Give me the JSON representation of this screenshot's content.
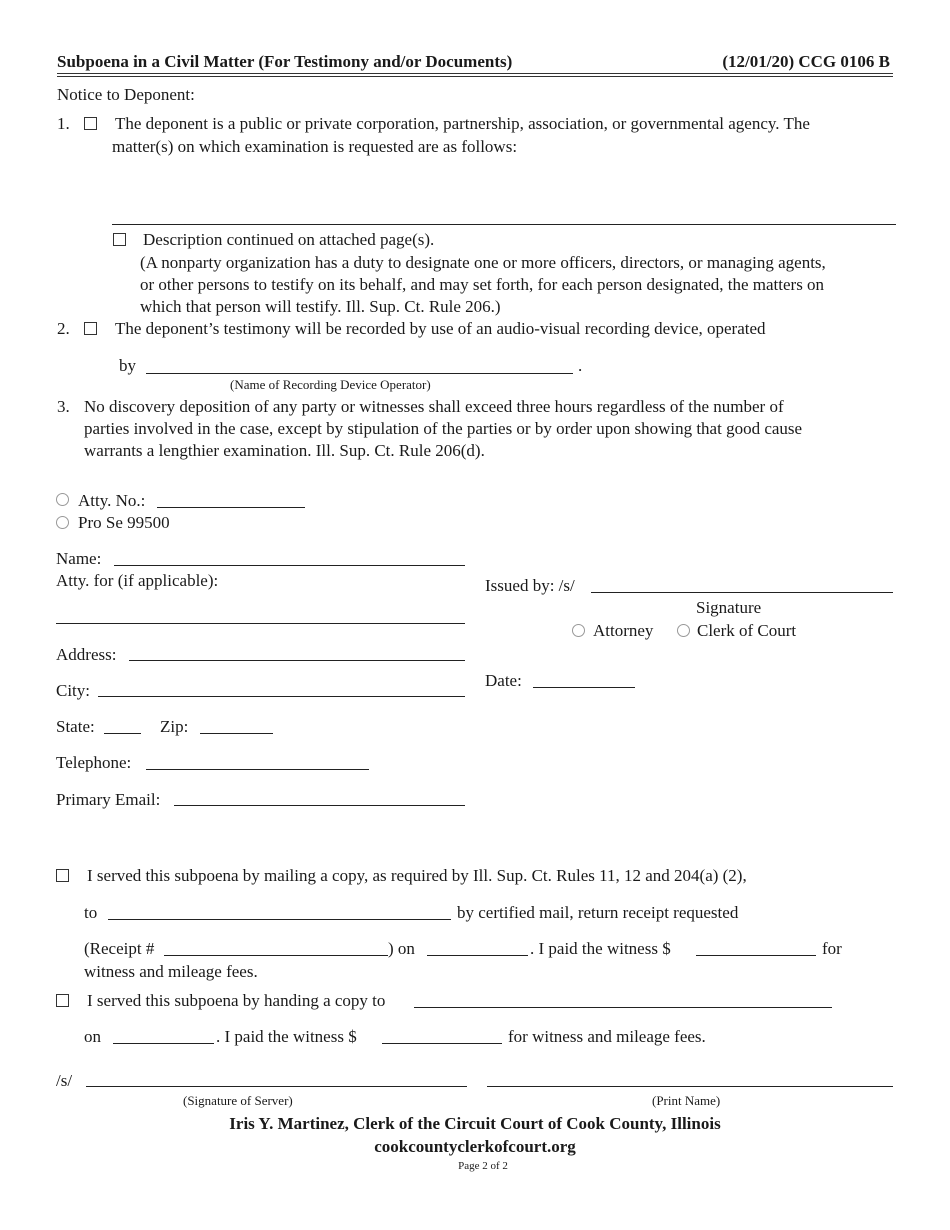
{
  "header": {
    "title": "Subpoena in a Civil Matter (For Testimony and/or Documents)",
    "form_code": "(12/01/20) CCG 0106 B"
  },
  "notice": {
    "heading": "Notice to Deponent:",
    "item1": {
      "number": "1.",
      "line1": "The deponent is a public or private corporation, partnership, association, or governmental agency.  The",
      "line2": "matter(s) on which examination is requested are as follows:",
      "matters_value": ""
    },
    "continued": {
      "label": "Description continued on attached page(s).",
      "note_lines": [
        "(A nonparty organization has a duty to designate one or more officers, directors, or managing agents,",
        "or other persons to testify on its behalf, and may set forth, for each person designated, the matters on",
        "which that person will testify.  Ill. Sup. Ct. Rule 206.)"
      ]
    },
    "item2": {
      "number": "2.",
      "text": "The deponent’s testimony will be recorded by use of an audio-visual recording device, operated",
      "by_label": "by",
      "period": ".",
      "operator_caption": "(Name of Recording Device Operator)",
      "operator_value": ""
    },
    "item3": {
      "number": "3.",
      "lines": [
        "No discovery deposition of any party or witnesses shall exceed three hours regardless of  the number of",
        "parties involved in the case, except by stipulation of  the parties or by order upon showing that good cause",
        "warrants a lengthier examination.  Ill. Sup. Ct. Rule 206(d)."
      ]
    }
  },
  "attorney": {
    "atty_no_label": "Atty. No.:",
    "atty_no_value": "",
    "pro_se_label": "Pro Se 99500",
    "name_label": "Name:",
    "atty_for_label": "Atty. for (if applicable):",
    "address_label": "Address:",
    "city_label": "City:",
    "state_label": "State:",
    "zip_label": "Zip:",
    "telephone_label": "Telephone:",
    "email_label": "Primary Email:"
  },
  "issuer": {
    "issued_by_label": "Issued by:  /s/",
    "signature_caption": "Signature",
    "attorney_option": "Attorney",
    "clerk_option": "Clerk of Court",
    "date_label": "Date:"
  },
  "service": {
    "mail": {
      "line1": "I served this subpoena by mailing a copy, as required by Ill. Sup. Ct. Rules 11, 12 and 204(a) (2),",
      "to_label": "to",
      "certified_text": "by certified mail, return receipt requested",
      "receipt_label": "(Receipt #",
      "on_label": ") on",
      "paid_text": ".  I paid the witness $",
      "for_label": "for",
      "fees_text": "witness and mileage fees."
    },
    "hand": {
      "line1": "I served this subpoena by handing a copy to",
      "on_label": "on",
      "paid_text": ".  I paid the witness $",
      "fees_text": "for witness and mileage fees."
    },
    "sig_prefix": "/s/",
    "sig_caption": "(Signature of Server)",
    "print_caption": "(Print Name)"
  },
  "footer": {
    "clerk_line": "Iris Y. Martinez, Clerk of  the Circuit Court of  Cook County, Illinois",
    "website": "cookcountyclerkofcourt.org",
    "page": "Page 2 of 2"
  }
}
